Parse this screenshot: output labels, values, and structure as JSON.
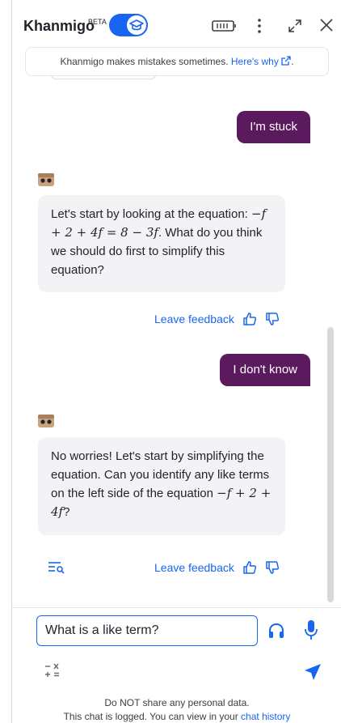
{
  "header": {
    "brand": "Khanmigo",
    "badge": "BETA"
  },
  "notice": {
    "text": "Khanmigo makes mistakes sometimes. ",
    "link": "Here's why"
  },
  "messages": [
    {
      "role": "user",
      "text": "I'm stuck"
    },
    {
      "role": "bot",
      "text_before": "Let's start by looking at the equation: ",
      "math": "−f + 2 + 4f = 8 − 3f",
      "text_after": ". What do you think we should do first to simplify this equation?"
    },
    {
      "role": "user",
      "text": "I don't know"
    },
    {
      "role": "bot",
      "text_before": "No worries! Let's start by simplifying the equation. Can you identify any like terms on the left side of the equation ",
      "math": "−f + 2 + 4f",
      "text_after": "?"
    }
  ],
  "feedback_label": "Leave feedback",
  "input": {
    "value": "What is a like term?"
  },
  "footer": {
    "line1": "Do NOT share any personal data.",
    "line2": "This chat is logged. You can view in your ",
    "link": "chat history"
  },
  "colors": {
    "accent": "#1865f2",
    "user_bubble": "#5b1a5e",
    "bot_bubble": "#f3f3f6"
  }
}
